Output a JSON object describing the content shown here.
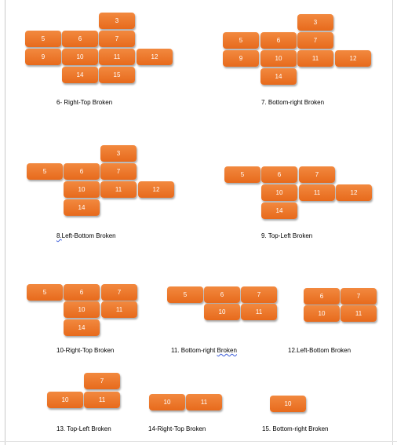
{
  "diagrams": [
    {
      "id": "d1",
      "caption": "6- Right-Top Broken",
      "tiles": [
        "3",
        "5",
        "6",
        "7",
        "9",
        "10",
        "11",
        "12",
        "14",
        "15"
      ]
    },
    {
      "id": "d2",
      "caption": "7. Bottom-right Broken",
      "tiles": [
        "3",
        "5",
        "6",
        "7",
        "9",
        "10",
        "11",
        "12",
        "14"
      ]
    },
    {
      "id": "d3",
      "caption_prefix": "8.",
      "caption_rest": "Left-Bottom Broken",
      "tiles": [
        "3",
        "5",
        "6",
        "7",
        "10",
        "11",
        "12",
        "14"
      ]
    },
    {
      "id": "d4",
      "caption": "9. Top-Left Broken",
      "tiles": [
        "5",
        "6",
        "7",
        "10",
        "11",
        "12",
        "14"
      ]
    },
    {
      "id": "d5",
      "caption": "10-Right-Top Broken",
      "tiles": [
        "5",
        "6",
        "7",
        "10",
        "11",
        "14"
      ]
    },
    {
      "id": "d6",
      "caption_prefix": "11. Bottom-right ",
      "caption_rest": "Broken",
      "tiles": [
        "5",
        "6",
        "7",
        "10",
        "11"
      ]
    },
    {
      "id": "d7",
      "caption": "12.Left-Bottom Broken",
      "tiles": [
        "6",
        "7",
        "10",
        "11"
      ]
    },
    {
      "id": "d8",
      "caption": "13. Top-Left Broken",
      "tiles": [
        "7",
        "10",
        "11"
      ]
    },
    {
      "id": "d9",
      "caption": "14-Right-Top Broken",
      "tiles": [
        "10",
        "11"
      ]
    },
    {
      "id": "d10",
      "caption": "15. Bottom-right Broken",
      "tiles": [
        "10"
      ]
    }
  ],
  "colors": {
    "tile": "#e87424",
    "tile_text": "#ffffff"
  }
}
